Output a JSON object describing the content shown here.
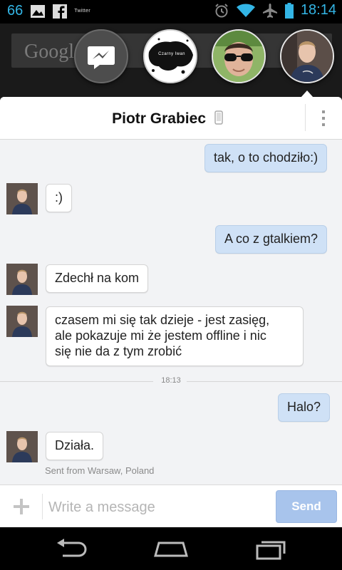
{
  "status_bar": {
    "notification_count": "66",
    "twitter_label": "Twitter",
    "time": "18:14",
    "accent_color": "#33b5e5",
    "icons": [
      "image-icon",
      "facebook-icon",
      "alarm-icon",
      "wifi-icon",
      "airplane-icon",
      "battery-icon"
    ]
  },
  "background": {
    "search_logo": "Googl"
  },
  "chat_heads": [
    {
      "name": "messenger-head",
      "icon": "messenger-icon"
    },
    {
      "name": "contact-head-1",
      "caption": "Czarny Iwan"
    },
    {
      "name": "contact-head-2"
    },
    {
      "name": "contact-head-3",
      "active": true
    }
  ],
  "conversation": {
    "contact_name": "Piotr Grabiec",
    "presence_icon": "phone-icon",
    "messages": [
      {
        "direction": "out",
        "text": "tak, o to chodziło:)"
      },
      {
        "direction": "in",
        "text": ":)"
      },
      {
        "direction": "out",
        "text": "A co z gtalkiem?"
      },
      {
        "direction": "in",
        "text": "Zdechł na kom"
      },
      {
        "direction": "in",
        "lines": [
          "czasem mi się tak dzieje - jest zasięg,",
          "ale pokazuje mi że jestem offline i nic",
          "się nie da z tym zrobić"
        ]
      },
      {
        "direction": "out",
        "text": "Halo?"
      },
      {
        "direction": "in",
        "text": "Działa."
      }
    ],
    "time_separator": "18:13",
    "location_note": "Sent from Warsaw, Poland"
  },
  "composer": {
    "placeholder": "Write a message",
    "value": "",
    "send_label": "Send",
    "send_color": "#a8c4ec"
  },
  "nav_bar": {
    "buttons": [
      "back-icon",
      "home-icon",
      "recents-icon"
    ]
  }
}
